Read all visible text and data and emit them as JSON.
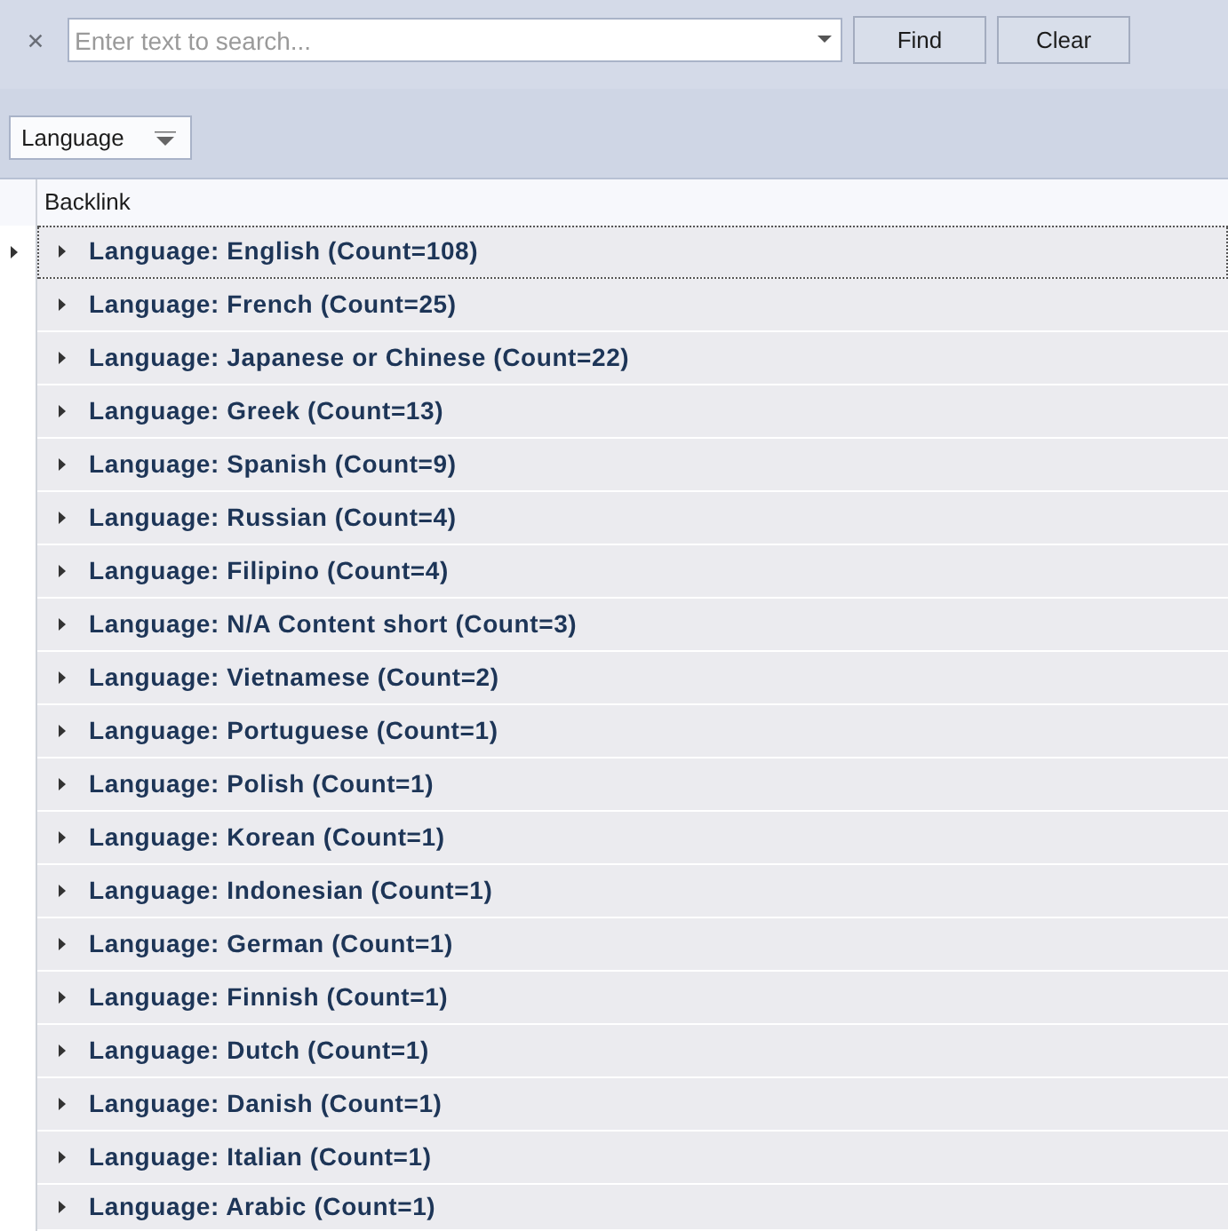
{
  "search_bar": {
    "placeholder": "Enter text to search...",
    "buttons": [
      "Find",
      "Clear"
    ]
  },
  "group_panel": {
    "chips": [
      {
        "label": "Language"
      }
    ]
  },
  "grid": {
    "columns": [
      "Backlink"
    ],
    "rows": [
      {
        "text": "Language: English (Count=108)",
        "focused": true,
        "expanded": false
      },
      {
        "text": "Language: French (Count=25)",
        "focused": false,
        "expanded": false
      },
      {
        "text": "Language: Japanese or Chinese (Count=22)",
        "focused": false,
        "expanded": false
      },
      {
        "text": "Language: Greek (Count=13)",
        "focused": false,
        "expanded": false
      },
      {
        "text": "Language: Spanish (Count=9)",
        "focused": false,
        "expanded": false
      },
      {
        "text": "Language: Russian (Count=4)",
        "focused": false,
        "expanded": false
      },
      {
        "text": "Language: Filipino (Count=4)",
        "focused": false,
        "expanded": false
      },
      {
        "text": "Language: N/A Content short (Count=3)",
        "focused": false,
        "expanded": false
      },
      {
        "text": "Language: Vietnamese (Count=2)",
        "focused": false,
        "expanded": false
      },
      {
        "text": "Language: Portuguese (Count=1)",
        "focused": false,
        "expanded": false
      },
      {
        "text": "Language: Polish (Count=1)",
        "focused": false,
        "expanded": false
      },
      {
        "text": "Language: Korean (Count=1)",
        "focused": false,
        "expanded": false
      },
      {
        "text": "Language: Indonesian (Count=1)",
        "focused": false,
        "expanded": false
      },
      {
        "text": "Language: German (Count=1)",
        "focused": false,
        "expanded": false
      },
      {
        "text": "Language: Finnish (Count=1)",
        "focused": false,
        "expanded": false
      },
      {
        "text": "Language: Dutch (Count=1)",
        "focused": false,
        "expanded": false
      },
      {
        "text": "Language: Danish (Count=1)",
        "focused": false,
        "expanded": false
      },
      {
        "text": "Language: Italian (Count=1)",
        "focused": false,
        "expanded": false
      },
      {
        "text": "Language: Arabic (Count=1)",
        "focused": false,
        "expanded": false
      }
    ]
  }
}
